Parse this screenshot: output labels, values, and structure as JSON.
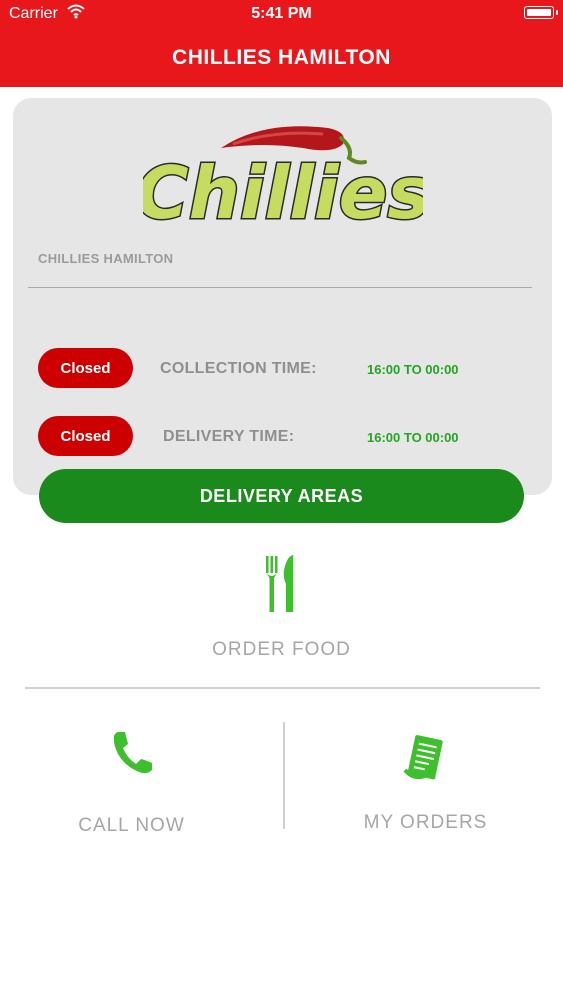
{
  "status_bar": {
    "carrier": "Carrier",
    "time": "5:41 PM",
    "icons": [
      "wifi-icon",
      "battery-icon"
    ]
  },
  "header": {
    "title": "CHILLIES HAMILTON"
  },
  "card": {
    "logo_text": "Chillies",
    "restaurant_name": "CHILLIES HAMILTON",
    "collection": {
      "status": "Closed",
      "label": "COLLECTION TIME:",
      "time": "16:00 TO 00:00"
    },
    "delivery": {
      "status": "Closed",
      "label": "DELIVERY TIME:",
      "time": "16:00 TO 00:00"
    }
  },
  "delivery_areas_button": "DELIVERY AREAS",
  "actions": {
    "order_food": {
      "label": "ORDER FOOD",
      "icon": "fork-knife-icon"
    },
    "call_now": {
      "label": "CALL NOW",
      "icon": "phone-icon"
    },
    "my_orders": {
      "label": "MY ORDERS",
      "icon": "receipt-icon"
    }
  },
  "colors": {
    "header_red": "#e8171c",
    "closed_red": "#cc0000",
    "primary_green": "#1a8a1d",
    "time_green": "#22a61f",
    "icon_green": "#3dbf2e",
    "card_gray": "#e7e6e7",
    "label_gray": "#a6a6a6"
  }
}
